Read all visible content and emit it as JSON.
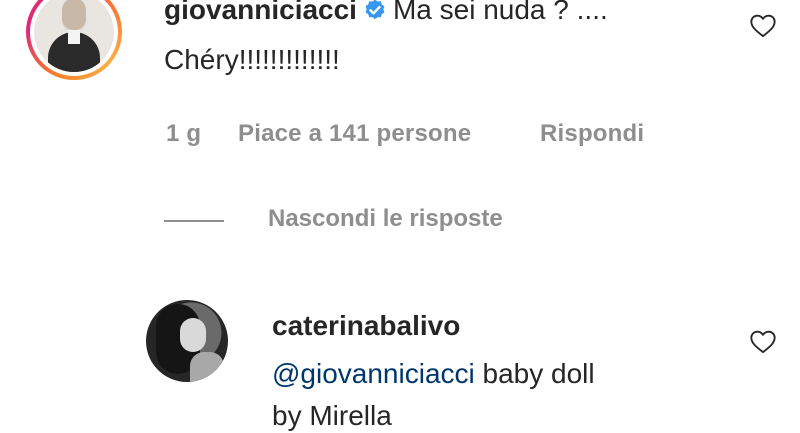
{
  "comment1": {
    "username": "giovanniciacci",
    "text_line1": "Ma sei nuda ? ....",
    "text_line2": "Chéry!!!!!!!!!!!!!",
    "time": "1 g",
    "likes": "Piace a 141 persone",
    "reply": "Rispondi",
    "replies_toggle": "Nascondi le risposte",
    "verified_icon": "verified-badge-icon",
    "like_icon": "heart-outline-icon"
  },
  "comment2": {
    "username": "caterinabalivo",
    "mention": "@giovanniciacci",
    "text_after_mention": " baby doll",
    "text_line3": "by Mirella",
    "like_icon": "heart-outline-icon"
  },
  "colors": {
    "text": "#262626",
    "muted": "#8e8e8e",
    "mention": "#00376b",
    "verified": "#3897f0"
  }
}
